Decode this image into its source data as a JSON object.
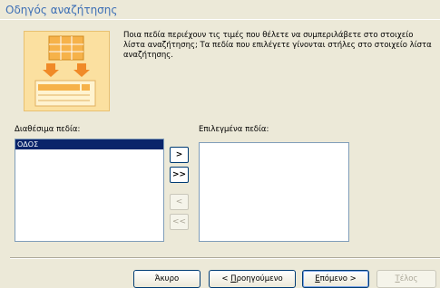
{
  "window": {
    "title": "Οδηγός αναζήτησης"
  },
  "intro": {
    "text": "Ποια πεδία περιέχουν τις τιμές που θέλετε να συμπεριλάβετε στο στοιχείο λίστα αναζήτησης; Τα πεδία που επιλέγετε γίνονται στήλες στο στοιχείο λίστα αναζήτησης."
  },
  "available": {
    "label": "Διαθέσιμα πεδία:",
    "items": [
      {
        "text": "ΟΔΟΣ",
        "selected": true
      }
    ]
  },
  "selected": {
    "label": "Επιλεγμένα πεδία:",
    "items": []
  },
  "move_buttons": {
    "add_one": ">",
    "add_all": ">>",
    "remove_one": "<",
    "remove_all": "<<"
  },
  "footer": {
    "cancel": "Άκυρο",
    "back_prefix": "< ",
    "back_key": "Π",
    "back_rest": "ροηγούμενο",
    "next_key": "Ε",
    "next_rest": "πόμενο >",
    "finish_key": "Τ",
    "finish_rest": "έλος"
  },
  "colors": {
    "title_text": "#3d6fb5",
    "selection": "#0a246a",
    "illustration": "#fbe0a0"
  }
}
